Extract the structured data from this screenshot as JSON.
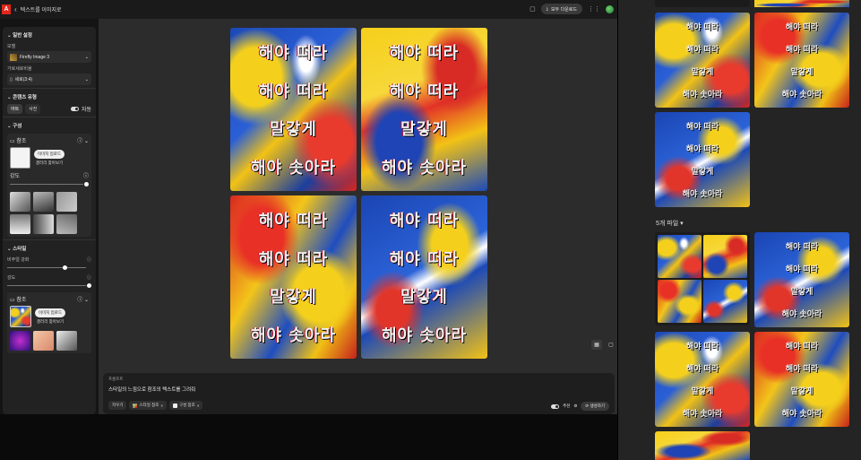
{
  "header": {
    "app_title": "텍스트를 이미지로",
    "download_all_label": "모두 다운로드"
  },
  "left_panel": {
    "general_settings": {
      "title": "일반 설정",
      "model_label": "모델",
      "model_value": "Firefly Image 3",
      "aspect_label": "가로세로비율",
      "aspect_value": "세로(3:4)"
    },
    "content_type": {
      "title": "콘텐츠 유형",
      "options": [
        "아트",
        "사진"
      ],
      "auto_label": "자동"
    },
    "composition": {
      "title": "구성",
      "reference_label": "참조",
      "upload_label": "이미지 업로드",
      "gallery_label": "갤러리 찾아보기",
      "strength_label": "강도",
      "strength_value": 1.0
    },
    "style": {
      "title": "스타일",
      "visual_intensity_label": "비주얼 강화",
      "visual_intensity_value": 0.65,
      "strength_label": "강도",
      "strength_value": 1.0,
      "reference_label": "참조",
      "upload_label": "이미지 업로드",
      "gallery_label": "갤러리 찾아보기"
    }
  },
  "canvas": {
    "images": [
      {
        "lines": [
          "해야 떠라",
          "해야 떠라",
          "말갛게",
          "해야 솟아라"
        ],
        "pattern": "pat-a"
      },
      {
        "lines": [
          "해야 떠라",
          "해야 떠라",
          "말갛게",
          "해야 솟아라"
        ],
        "pattern": "pat-b"
      },
      {
        "lines": [
          "해야 떠라",
          "해야 떠라",
          "말갛게",
          "해야 솟아라"
        ],
        "pattern": "pat-c"
      },
      {
        "lines": [
          "해야 떠라",
          "해야 떠라",
          "말갛게",
          "해야 솟아라"
        ],
        "pattern": "pat-d"
      }
    ]
  },
  "prompt": {
    "label": "프롬프트",
    "text": "스타일의 느낌으로 참조의 텍스트를 그려줘",
    "clear_label": "지우기",
    "style_chip": "스타일 참조",
    "composition_chip": "구성 참조",
    "suggest_label": "추천",
    "generate_label": "생성하기"
  },
  "history": {
    "files_label": "5개 파일",
    "thumb_lines": [
      "해야 떠라",
      "해야 떠라",
      "말갛게",
      "해야 솟아라"
    ]
  },
  "colors": {
    "accent_red": "#e1251b",
    "paint_blue": "#1c49b8",
    "paint_yellow": "#f4d01c",
    "paint_red": "#e83b2e"
  }
}
